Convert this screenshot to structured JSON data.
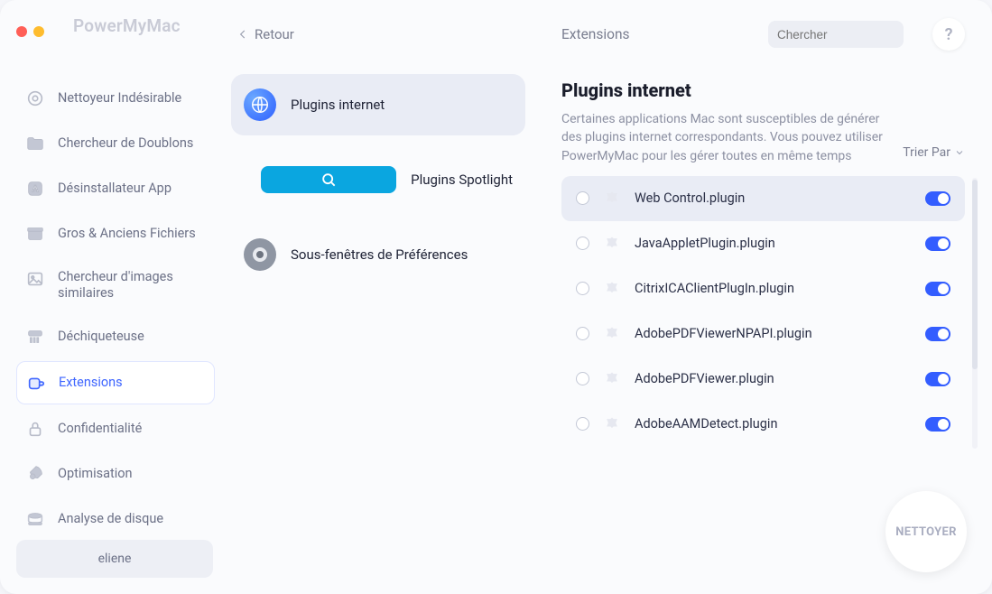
{
  "app": {
    "title": "PowerMyMac"
  },
  "back": "Retour",
  "sidebar": {
    "items": [
      {
        "label": "Nettoyeur Indésirable"
      },
      {
        "label": "Chercheur de Doublons"
      },
      {
        "label": "Désinstallateur App"
      },
      {
        "label": "Gros & Anciens Fichiers"
      },
      {
        "label": "Chercheur d'images similaires"
      },
      {
        "label": "Déchiqueteuse"
      },
      {
        "label": "Extensions"
      },
      {
        "label": "Confidentialité"
      },
      {
        "label": "Optimisation"
      },
      {
        "label": "Analyse de disque"
      }
    ],
    "active_index": 6
  },
  "user": "eliene",
  "categories": {
    "items": [
      {
        "label": "Plugins internet"
      },
      {
        "label": "Plugins Spotlight"
      },
      {
        "label": "Sous-fenêtres de Préférences"
      }
    ],
    "selected_index": 0
  },
  "main": {
    "section": "Extensions",
    "search_placeholder": "Chercher",
    "title": "Plugins internet",
    "description": "Certaines applications Mac sont susceptibles de générer des plugins internet correspondants. Vous pouvez utiliser PowerMyMac pour les gérer toutes en même temps",
    "sort_label": "Trier Par",
    "plugins": [
      {
        "name": "Web Control.plugin",
        "enabled": true
      },
      {
        "name": "JavaAppletPlugin.plugin",
        "enabled": true
      },
      {
        "name": "CitrixICAClientPlugIn.plugin",
        "enabled": true
      },
      {
        "name": "AdobePDFViewerNPAPI.plugin",
        "enabled": true
      },
      {
        "name": "AdobePDFViewer.plugin",
        "enabled": true
      },
      {
        "name": "AdobeAAMDetect.plugin",
        "enabled": true
      }
    ],
    "clean_button": "NETTOYER"
  }
}
